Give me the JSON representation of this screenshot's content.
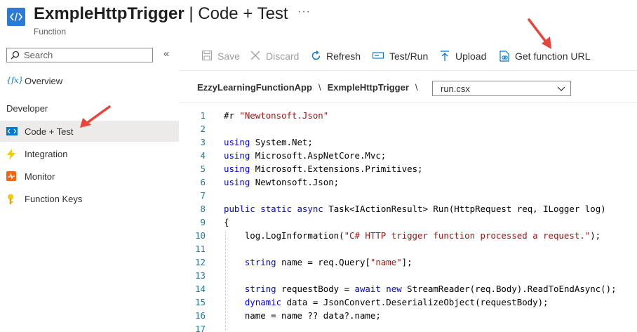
{
  "header": {
    "title_bold": "ExmpleHttpTrigger",
    "title_rest": " | Code + Test",
    "subtitle": "Function",
    "more": "···"
  },
  "sidebar": {
    "search_placeholder": "Search",
    "collapse": "«",
    "overview": "Overview",
    "section_developer": "Developer",
    "items": [
      {
        "label": "Code + Test"
      },
      {
        "label": "Integration"
      },
      {
        "label": "Monitor"
      },
      {
        "label": "Function Keys"
      }
    ]
  },
  "toolbar": {
    "save": "Save",
    "discard": "Discard",
    "refresh": "Refresh",
    "test_run": "Test/Run",
    "upload": "Upload",
    "get_url": "Get function URL"
  },
  "breadcrumb": {
    "app": "EzzyLearningFunctionApp",
    "function": "ExmpleHttpTrigger",
    "sep": "\\",
    "file": "run.csx"
  },
  "editor": {
    "lines": [
      {
        "n": "1",
        "segs": [
          [
            "#r",
            "p"
          ],
          [
            " ",
            "ws"
          ],
          [
            "\"Newtonsoft.Json\"",
            "str"
          ]
        ]
      },
      {
        "n": "2",
        "segs": []
      },
      {
        "n": "3",
        "segs": [
          [
            "using",
            "kw"
          ],
          [
            " System.Net;",
            "p"
          ]
        ]
      },
      {
        "n": "4",
        "segs": [
          [
            "using",
            "kw"
          ],
          [
            " Microsoft.AspNetCore.Mvc;",
            "p"
          ]
        ]
      },
      {
        "n": "5",
        "segs": [
          [
            "using",
            "kw"
          ],
          [
            " Microsoft.Extensions.Primitives;",
            "p"
          ]
        ]
      },
      {
        "n": "6",
        "segs": [
          [
            "using",
            "kw"
          ],
          [
            " Newtonsoft.Json;",
            "p"
          ]
        ]
      },
      {
        "n": "7",
        "segs": []
      },
      {
        "n": "8",
        "segs": [
          [
            "public",
            "kw"
          ],
          [
            " ",
            "p"
          ],
          [
            "static",
            "kw"
          ],
          [
            " ",
            "p"
          ],
          [
            "async",
            "kw"
          ],
          [
            " Task<IActionResult> Run(HttpRequest req, ILogger log)",
            "p"
          ]
        ]
      },
      {
        "n": "9",
        "segs": [
          [
            "{",
            "p"
          ]
        ]
      },
      {
        "n": "10",
        "segs": [
          [
            "    log.LogInformation(",
            "p"
          ],
          [
            "\"C# HTTP trigger function processed a request.\"",
            "str"
          ],
          [
            ");",
            "p"
          ]
        ]
      },
      {
        "n": "11",
        "segs": []
      },
      {
        "n": "12",
        "segs": [
          [
            "    ",
            "p"
          ],
          [
            "string",
            "kw"
          ],
          [
            " name = req.Query[",
            "p"
          ],
          [
            "\"name\"",
            "str"
          ],
          [
            "];",
            "p"
          ]
        ]
      },
      {
        "n": "13",
        "segs": []
      },
      {
        "n": "14",
        "segs": [
          [
            "    ",
            "p"
          ],
          [
            "string",
            "kw"
          ],
          [
            " requestBody = ",
            "p"
          ],
          [
            "await",
            "kw"
          ],
          [
            " ",
            "p"
          ],
          [
            "new",
            "kw"
          ],
          [
            " StreamReader(req.Body).ReadToEndAsync();",
            "p"
          ]
        ]
      },
      {
        "n": "15",
        "segs": [
          [
            "    ",
            "p"
          ],
          [
            "dynamic",
            "kw"
          ],
          [
            " data = JsonConvert.DeserializeObject(requestBody);",
            "p"
          ]
        ]
      },
      {
        "n": "16",
        "segs": [
          [
            "    name = name ?? data?.name;",
            "p"
          ]
        ]
      },
      {
        "n": "17",
        "segs": []
      }
    ]
  },
  "colors": {
    "accent": "#0078d4",
    "keyword": "#0000ff",
    "string": "#a31515",
    "line_number": "#237893",
    "annotation_arrow": "#e8453c"
  }
}
